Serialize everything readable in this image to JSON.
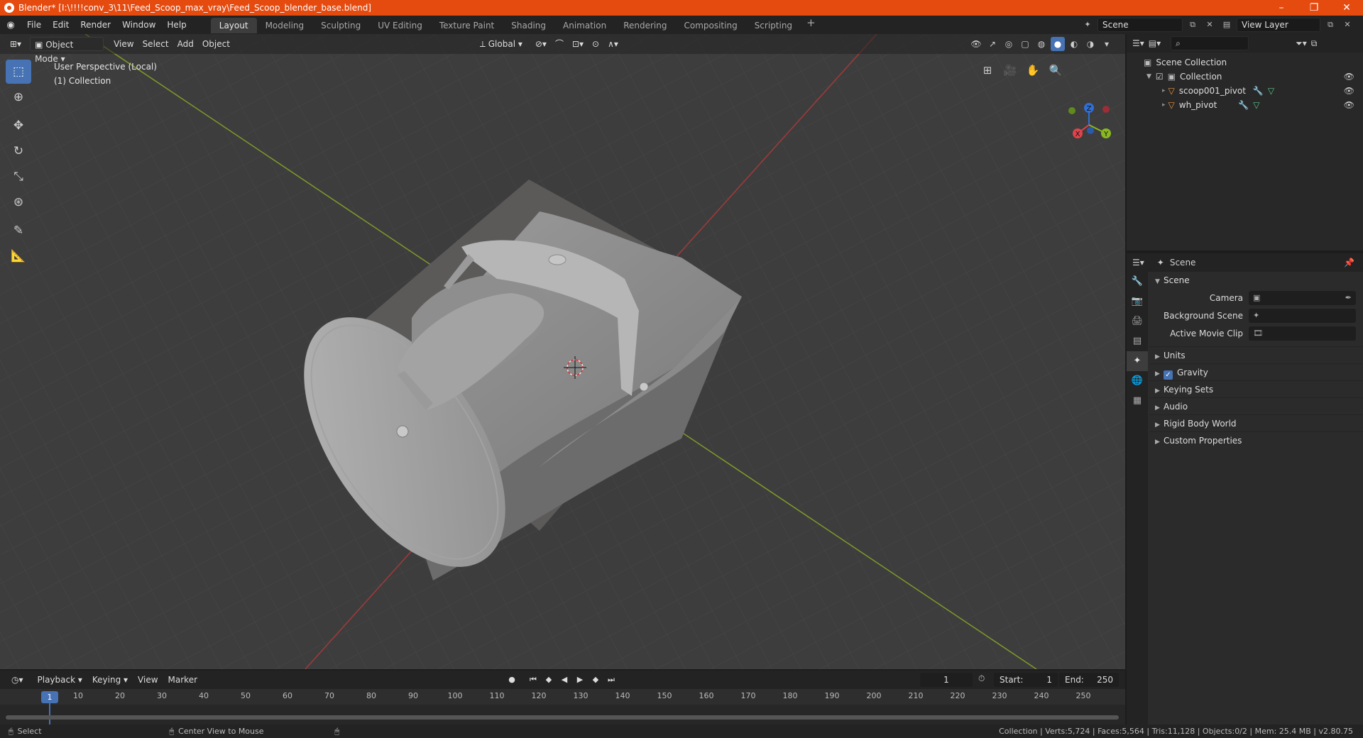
{
  "window": {
    "title": "Blender* [I:\\!!!!conv_3\\11\\Feed_Scoop_max_vray\\Feed_Scoop_blender_base.blend]",
    "minimize": "–",
    "restore": "❐",
    "close": "✕"
  },
  "menu": [
    "File",
    "Edit",
    "Render",
    "Window",
    "Help"
  ],
  "workspaces": [
    "Layout",
    "Modeling",
    "Sculpting",
    "UV Editing",
    "Texture Paint",
    "Shading",
    "Animation",
    "Rendering",
    "Compositing",
    "Scripting"
  ],
  "active_workspace": "Layout",
  "scene_selector": {
    "scene": "Scene",
    "view_layer": "View Layer"
  },
  "viewport": {
    "mode": "Object Mode",
    "menus": [
      "View",
      "Select",
      "Add",
      "Object"
    ],
    "transform_orientation": "Global",
    "perspective_label": "User Perspective (Local)",
    "collection_label": "(1) Collection",
    "gizmo_axes": {
      "x": "X",
      "y": "Y",
      "z": "Z"
    }
  },
  "outliner": {
    "root": "Scene Collection",
    "collection": "Collection",
    "objects": [
      "scoop001_pivot",
      "wh_pivot"
    ]
  },
  "properties": {
    "header": "Scene",
    "panel": "Scene",
    "fields": [
      {
        "label": "Camera",
        "value": ""
      },
      {
        "label": "Background Scene",
        "value": ""
      },
      {
        "label": "Active Movie Clip",
        "value": ""
      }
    ],
    "subpanels": [
      "Units",
      "Gravity",
      "Keying Sets",
      "Audio",
      "Rigid Body World",
      "Custom Properties"
    ],
    "gravity_enabled": true
  },
  "timeline": {
    "menus": [
      "Playback",
      "Keying",
      "View",
      "Marker"
    ],
    "current_frame": "1",
    "start_label": "Start:",
    "start": "1",
    "end_label": "End:",
    "end": "250",
    "ruler": [
      "1",
      "10",
      "20",
      "30",
      "40",
      "50",
      "60",
      "70",
      "80",
      "90",
      "100",
      "110",
      "120",
      "130",
      "140",
      "150",
      "160",
      "170",
      "180",
      "190",
      "200",
      "210",
      "220",
      "230",
      "240",
      "250"
    ]
  },
  "statusbar": {
    "left_action": "Select",
    "middle_action": "Center View to Mouse",
    "stats": "Collection | Verts:5,724 | Faces:5,564 | Tris:11,128 | Objects:0/2 | Mem: 25.4 MB | v2.80.75"
  },
  "colors": {
    "accent": "#4772b3",
    "titlebar": "#e54a0f",
    "viewport_bg": "#3d3d3d"
  }
}
